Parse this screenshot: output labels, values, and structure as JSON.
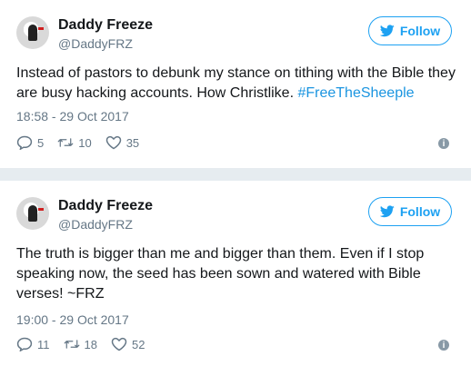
{
  "tweets": [
    {
      "name": "Daddy Freeze",
      "handle": "@DaddyFRZ",
      "follow_label": "Follow",
      "text": "Instead of pastors to debunk my stance on tithing with the Bible they are busy hacking accounts. How Christlike. ",
      "hashtag": "#FreeTheSheeple",
      "timestamp": "18:58 - 29 Oct 2017",
      "replies": "5",
      "retweets": "10",
      "likes": "35",
      "info_icon": "i"
    },
    {
      "name": "Daddy Freeze",
      "handle": "@DaddyFRZ",
      "follow_label": "Follow",
      "text": "The truth is bigger than me and bigger than them. Even if I stop speaking now, the seed has been sown and watered with Bible verses! ~FRZ",
      "timestamp": "19:00 - 29 Oct 2017",
      "replies": "11",
      "retweets": "18",
      "likes": "52",
      "info_icon": "i"
    }
  ],
  "colors": {
    "brand_blue": "#1da1f2",
    "hashtag_blue": "#1b95e0",
    "muted": "#657786",
    "separator": "#e6ecf0"
  }
}
